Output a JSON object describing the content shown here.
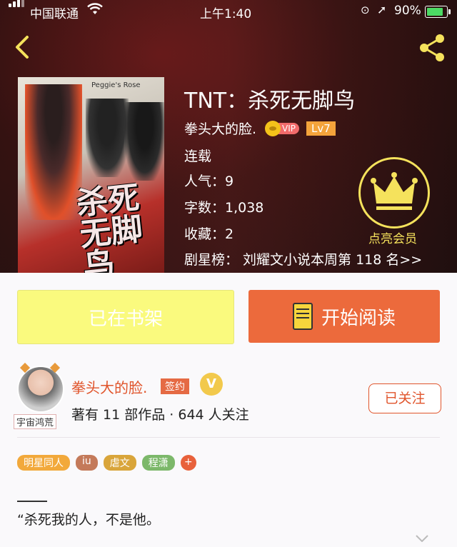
{
  "status_bar": {
    "carrier": "中国联通",
    "time": "上午1:40",
    "battery": "90%"
  },
  "book": {
    "title": "TNT：杀死无脚鸟",
    "author": "拳头大的脸.",
    "vip_label": "VIP",
    "level": "Lv7",
    "status": "连载",
    "popularity": "人气：9",
    "word_count": "字数：1,038",
    "favorites": "收藏：2",
    "ranking": "剧星榜：  刘耀文小说本周第 118 名>>",
    "cover_title": "杀死无脚鸟",
    "cover_top_text": "Peggie's Rose"
  },
  "membership": {
    "label": "点亮会员"
  },
  "actions": {
    "shelf": "已在书架",
    "read": "开始阅读"
  },
  "author_card": {
    "name": "拳头大的脸.",
    "sign": "签约",
    "badge": "V",
    "stats": "著有 11 部作品 · 644 人关注",
    "avatar_tag": "宇宙鸿荒",
    "follow": "已关注"
  },
  "tags": [
    {
      "label": "明星同人",
      "color": "#f2a93b"
    },
    {
      "label": "iu",
      "color": "#c47a5a"
    },
    {
      "label": "虐文",
      "color": "#d9a53a"
    },
    {
      "label": "程潇",
      "color": "#7cb86a"
    }
  ],
  "tags_more": "+",
  "intro": {
    "first_line": "“杀死我的人，不是他。"
  }
}
